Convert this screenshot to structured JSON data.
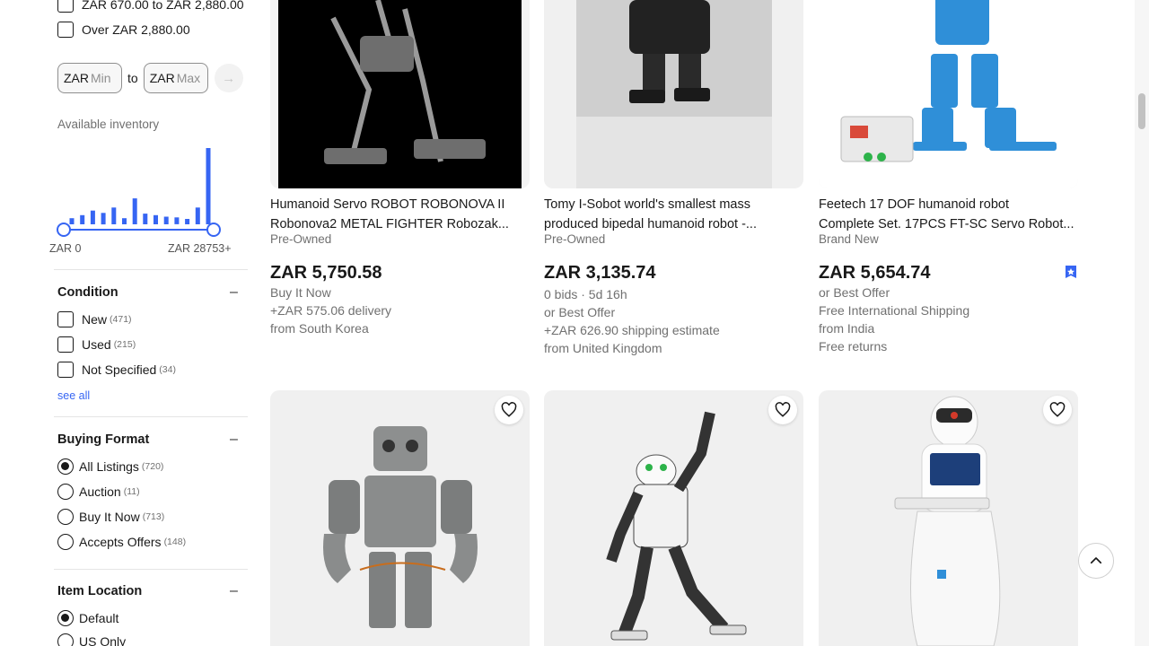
{
  "filters": {
    "price": {
      "options": [
        {
          "label": "ZAR 670.00 to ZAR 2,880.00"
        },
        {
          "label": "Over ZAR 2,880.00"
        }
      ],
      "currency_prefix": "ZAR",
      "min_placeholder": "Min",
      "max_placeholder": "Max",
      "to_label": "to",
      "available_inventory": "Available inventory",
      "histogram": {
        "values": [
          0.08,
          0.12,
          0.18,
          0.15,
          0.22,
          0.08,
          0.34,
          0.14,
          0.12,
          0.1,
          0.09,
          0.07,
          0.22,
          1.0
        ],
        "color": "#3665f3",
        "min_label": "ZAR 0",
        "max_label": "ZAR 28753+"
      }
    },
    "condition": {
      "title": "Condition",
      "toggle": "–",
      "options": [
        {
          "label": "New",
          "count": "(471)"
        },
        {
          "label": "Used",
          "count": "(215)"
        },
        {
          "label": "Not Specified",
          "count": "(34)"
        }
      ],
      "see_all": "see all"
    },
    "buying_format": {
      "title": "Buying Format",
      "toggle": "–",
      "options": [
        {
          "label": "All Listings",
          "count": "(720)",
          "selected": true
        },
        {
          "label": "Auction",
          "count": "(11)",
          "selected": false
        },
        {
          "label": "Buy It Now",
          "count": "(713)",
          "selected": false
        },
        {
          "label": "Accepts Offers",
          "count": "(148)",
          "selected": false
        }
      ]
    },
    "item_location": {
      "title": "Item Location",
      "toggle": "–",
      "options": [
        {
          "label": "Default",
          "selected": true
        },
        {
          "label": "US Only",
          "selected": false
        }
      ]
    }
  },
  "listings": [
    {
      "title_line1": "Humanoid Servo ROBOT ROBONOVA II",
      "title_line2": "Robonova2 METAL FIGHTER Robozak...",
      "condition": "Pre-Owned",
      "price": "ZAR 5,750.58",
      "details": [
        "Buy It Now",
        "+ZAR 575.06 delivery",
        "from South Korea"
      ]
    },
    {
      "title_line1": "Tomy I-Sobot world's smallest mass",
      "title_line2": "produced bipedal humanoid robot -...",
      "condition": "Pre-Owned",
      "price": "ZAR 3,135.74",
      "details": [
        "0 bids · 5d 16h",
        "or Best Offer",
        "+ZAR 626.90 shipping estimate",
        "from United Kingdom"
      ]
    },
    {
      "title_line1": "Feetech 17 DOF humanoid robot",
      "title_line2": "Complete Set. 17PCS FT-SC Servo Robot...",
      "condition": "Brand New",
      "price": "ZAR 5,654.74",
      "details": [
        "or Best Offer",
        "Free International Shipping",
        "from India",
        "Free returns"
      ]
    }
  ],
  "colors": {
    "accent": "#3665f3",
    "text": "#191919",
    "muted": "#707070"
  }
}
